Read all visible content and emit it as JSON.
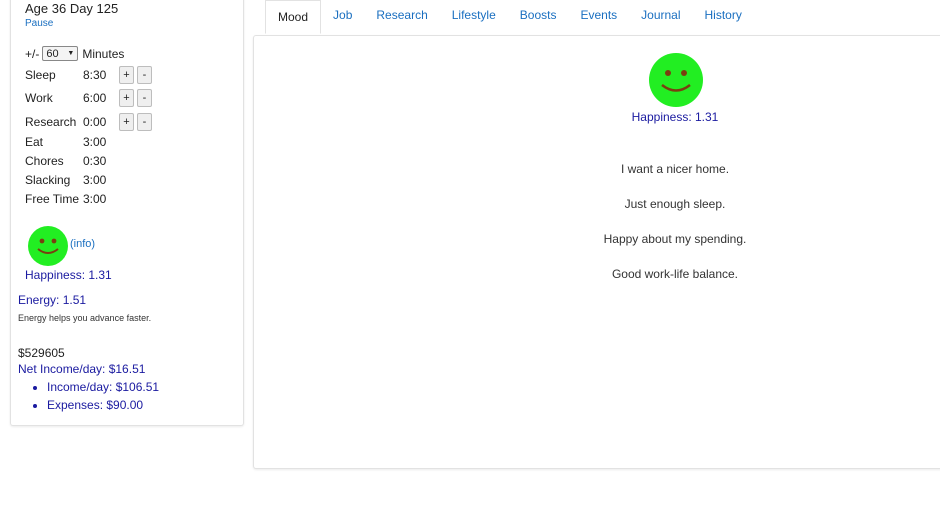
{
  "status": {
    "age_line": "Age 36 Day 125",
    "pause_label": "Pause"
  },
  "schedule": {
    "step_prefix": "+/-",
    "step_value": "60",
    "step_unit": "Minutes",
    "rows": [
      {
        "label": "Sleep",
        "value": "8:30",
        "adjustable": true
      },
      {
        "label": "Work",
        "value": "6:00",
        "adjustable": true
      },
      {
        "label": "Research",
        "value": "0:00",
        "adjustable": true
      },
      {
        "label": "Eat",
        "value": "3:00",
        "adjustable": false
      },
      {
        "label": "Chores",
        "value": "0:30",
        "adjustable": false
      },
      {
        "label": "Slacking",
        "value": "3:00",
        "adjustable": false
      },
      {
        "label": "Free Time",
        "value": "3:00",
        "adjustable": false
      }
    ],
    "plus_label": "+",
    "minus_label": "-"
  },
  "mood_summary": {
    "info_label": "(info)",
    "happiness_text": "Happiness: 1.31",
    "face_color": "#22ee22"
  },
  "energy": {
    "text": "Energy: 1.51",
    "note": "Energy helps you advance faster."
  },
  "finances": {
    "money": "$529605",
    "net_income": "Net Income/day: $16.51",
    "items": [
      "Income/day: $106.51",
      "Expenses: $90.00"
    ]
  },
  "tabs": [
    {
      "label": "Mood",
      "active": true
    },
    {
      "label": "Job",
      "active": false
    },
    {
      "label": "Research",
      "active": false
    },
    {
      "label": "Lifestyle",
      "active": false
    },
    {
      "label": "Boosts",
      "active": false
    },
    {
      "label": "Events",
      "active": false
    },
    {
      "label": "Journal",
      "active": false
    },
    {
      "label": "History",
      "active": false
    }
  ],
  "mood_tab": {
    "happiness_text": "Happiness: 1.31",
    "thoughts": [
      "I want a nicer home.",
      "Just enough sleep.",
      "Happy about my spending.",
      "Good work-life balance."
    ]
  },
  "colors": {
    "link": "#1a6fc0",
    "value_text": "#1a1aa0",
    "face": "#22ee22"
  }
}
